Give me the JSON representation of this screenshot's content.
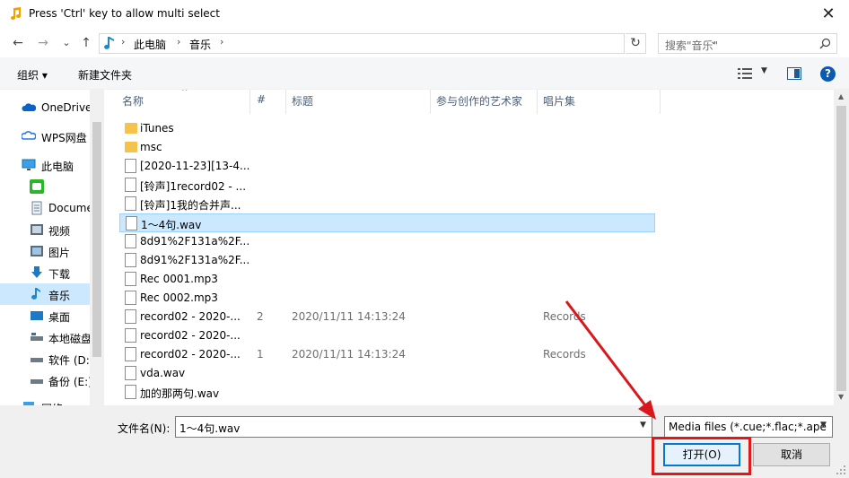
{
  "window": {
    "title": "Press 'Ctrl' key to allow multi select",
    "close": "✕"
  },
  "nav": {
    "back": "←",
    "forward": "→",
    "recent": "⌄",
    "up": "↑"
  },
  "address": {
    "crumbs": [
      "此电脑",
      "音乐"
    ],
    "sep": "›",
    "refresh": "↻",
    "dropdown": "⌄"
  },
  "search": {
    "placeholder": "搜索\"音乐\""
  },
  "toolbar": {
    "organize": "组织 ▾",
    "new_folder": "新建文件夹",
    "help": "?"
  },
  "sidebar": {
    "items": [
      {
        "label": "OneDrive",
        "icon": "cloud-icon"
      },
      {
        "label": "WPS网盘",
        "icon": "wps-cloud-icon"
      },
      {
        "label": "此电脑",
        "icon": "computer-icon"
      },
      {
        "label": "",
        "icon": "wechat-icon"
      },
      {
        "label": "Documents",
        "icon": "documents-icon"
      },
      {
        "label": "视频",
        "icon": "video-icon"
      },
      {
        "label": "图片",
        "icon": "pictures-icon"
      },
      {
        "label": "下载",
        "icon": "download-icon"
      },
      {
        "label": "音乐",
        "icon": "music-icon"
      },
      {
        "label": "桌面",
        "icon": "desktop-icon"
      },
      {
        "label": "本地磁盘 (C:)",
        "icon": "drive-icon"
      },
      {
        "label": "软件 (D:)",
        "icon": "drive-icon"
      },
      {
        "label": "备份 (E:)",
        "icon": "drive-icon"
      },
      {
        "label": "网络",
        "icon": "network-icon"
      }
    ]
  },
  "columns": {
    "name": "名称",
    "num": "#",
    "title": "标题",
    "artist": "参与创作的艺术家",
    "album": "唱片集",
    "sort": "^"
  },
  "files": [
    {
      "name": "iTunes",
      "type": "folder",
      "num": "",
      "title": "",
      "album": ""
    },
    {
      "name": "msc",
      "type": "folder",
      "num": "",
      "title": "",
      "album": ""
    },
    {
      "name": "[2020-11-23][13-4...",
      "type": "file",
      "num": "",
      "title": "",
      "album": ""
    },
    {
      "name": "[铃声]1record02 - ...",
      "type": "file",
      "num": "",
      "title": "",
      "album": ""
    },
    {
      "name": "[铃声]1我的合并声...",
      "type": "file",
      "num": "",
      "title": "",
      "album": ""
    },
    {
      "name": "1～4句.wav",
      "type": "file",
      "num": "",
      "title": "",
      "album": ""
    },
    {
      "name": "8d91%2F131a%2F...",
      "type": "file",
      "num": "",
      "title": "",
      "album": ""
    },
    {
      "name": "8d91%2F131a%2F...",
      "type": "file",
      "num": "",
      "title": "",
      "album": ""
    },
    {
      "name": "Rec 0001.mp3",
      "type": "file",
      "num": "",
      "title": "",
      "album": ""
    },
    {
      "name": "Rec 0002.mp3",
      "type": "file",
      "num": "",
      "title": "",
      "album": ""
    },
    {
      "name": "record02 - 2020-...",
      "type": "file",
      "num": "2",
      "title": "2020/11/11 14:13:24",
      "album": "Records"
    },
    {
      "name": "record02 - 2020-...",
      "type": "file",
      "num": "",
      "title": "",
      "album": ""
    },
    {
      "name": "record02 - 2020-...",
      "type": "file",
      "num": "1",
      "title": "2020/11/11 14:13:24",
      "album": "Records"
    },
    {
      "name": "vda.wav",
      "type": "file",
      "num": "",
      "title": "",
      "album": ""
    },
    {
      "name": "加的那两句.wav",
      "type": "file",
      "num": "",
      "title": "",
      "album": ""
    }
  ],
  "selected_index": 5,
  "bottom": {
    "filename_label": "文件名(N):",
    "filename_value": "1～4句.wav",
    "filter_value": "Media files (*.cue;*.flac;*.ape",
    "open_label": "打开(O)",
    "cancel_label": "取消"
  },
  "colors": {
    "selection": "#cce8ff",
    "highlight": "#e0171b",
    "accent": "#0078d7"
  }
}
